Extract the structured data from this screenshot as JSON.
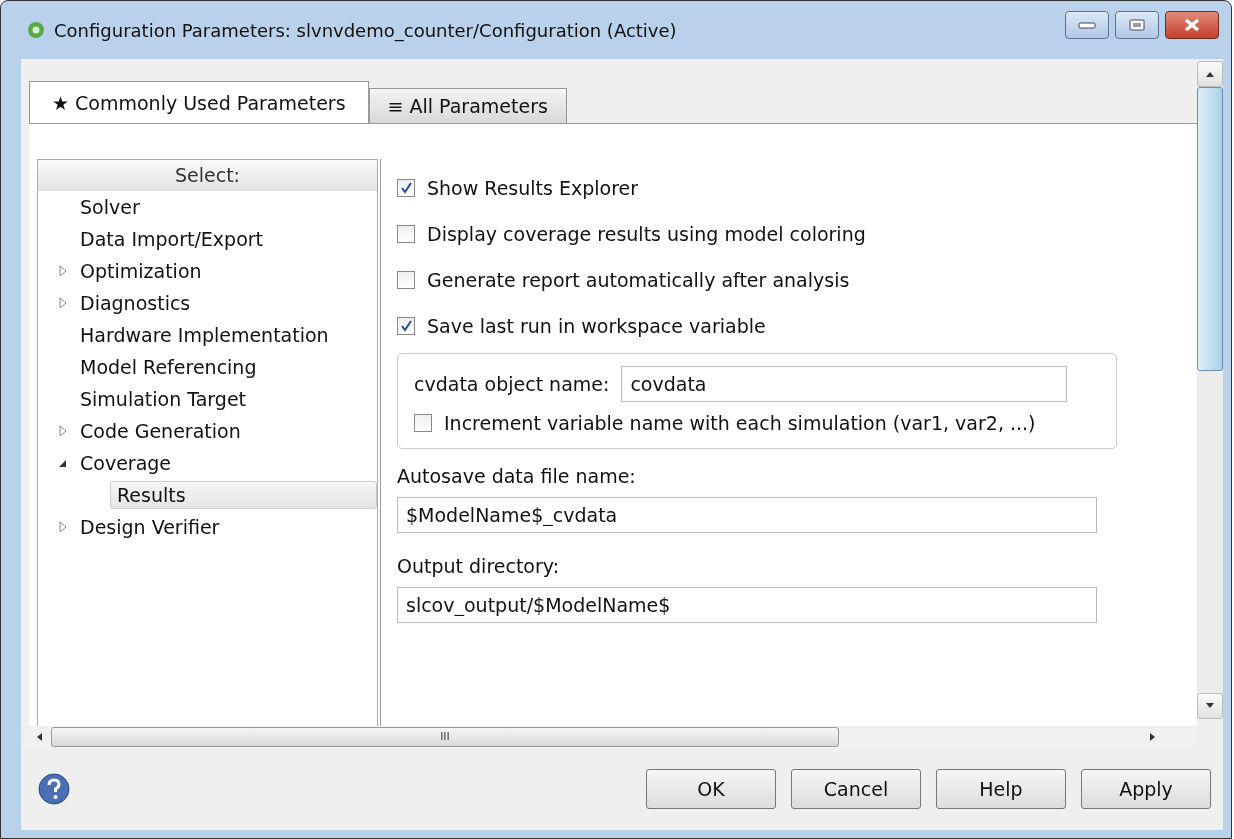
{
  "window": {
    "title": "Configuration Parameters: slvnvdemo_counter/Configuration (Active)"
  },
  "tabs": [
    {
      "icon": "★",
      "label": "Commonly Used Parameters",
      "selected": true
    },
    {
      "icon": "≡",
      "label": "All Parameters",
      "selected": false
    }
  ],
  "tree": {
    "header": "Select:",
    "items": [
      {
        "label": "Solver",
        "kind": "leaf",
        "selected": false
      },
      {
        "label": "Data Import/Export",
        "kind": "leaf",
        "selected": false
      },
      {
        "label": "Optimization",
        "kind": "branch",
        "expanded": false,
        "selected": false
      },
      {
        "label": "Diagnostics",
        "kind": "branch",
        "expanded": false,
        "selected": false
      },
      {
        "label": "Hardware Implementation",
        "kind": "leaf",
        "selected": false
      },
      {
        "label": "Model Referencing",
        "kind": "leaf",
        "selected": false
      },
      {
        "label": "Simulation Target",
        "kind": "leaf",
        "selected": false
      },
      {
        "label": "Code Generation",
        "kind": "branch",
        "expanded": false,
        "selected": false
      },
      {
        "label": "Coverage",
        "kind": "branch",
        "expanded": true,
        "selected": false,
        "children": [
          {
            "label": "Results",
            "selected": true
          }
        ]
      },
      {
        "label": "Design Verifier",
        "kind": "branch",
        "expanded": false,
        "selected": false
      }
    ]
  },
  "options": [
    {
      "label": "Show Results Explorer",
      "checked": true
    },
    {
      "label": "Display coverage results using model coloring",
      "checked": false
    },
    {
      "label": "Generate report automatically after analysis",
      "checked": false
    },
    {
      "label": "Save last run in workspace variable",
      "checked": true
    }
  ],
  "group": {
    "name_label": "cvdata object name:",
    "name_value": "covdata",
    "increment": {
      "label": "Increment variable name with each simulation (var1, var2, ...)",
      "checked": false
    }
  },
  "fields": [
    {
      "label": "Autosave data file name:",
      "value": "$ModelName$_cvdata"
    },
    {
      "label": "Output directory:",
      "value": "slcov_output/$ModelName$"
    }
  ],
  "scrollbar": {
    "grip": "III"
  },
  "buttons": [
    "OK",
    "Cancel",
    "Help",
    "Apply"
  ]
}
